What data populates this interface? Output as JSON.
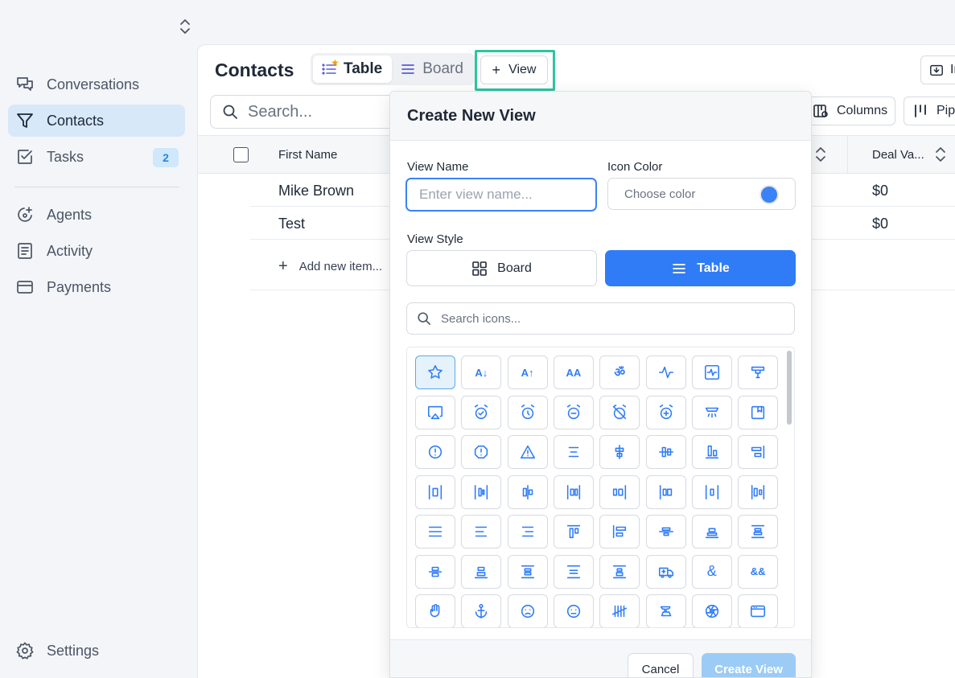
{
  "sidebar": {
    "items": [
      {
        "label": "Conversations",
        "icon": "chat-icon"
      },
      {
        "label": "Contacts",
        "icon": "filter-icon",
        "active": true
      },
      {
        "label": "Tasks",
        "icon": "checkbox-icon",
        "badge": "2"
      },
      {
        "label": "Agents",
        "icon": "sparkle-icon"
      },
      {
        "label": "Activity",
        "icon": "document-icon"
      },
      {
        "label": "Payments",
        "icon": "card-icon"
      }
    ],
    "settings_label": "Settings"
  },
  "header": {
    "title": "Contacts",
    "tabs": [
      {
        "label": "Table",
        "active": true
      },
      {
        "label": "Board"
      }
    ],
    "add_view_label": "View",
    "right_button_label": "Im"
  },
  "toolbar": {
    "search_placeholder": "Search...",
    "columns_label": "Columns",
    "pipeline_label": "Pipe"
  },
  "table": {
    "columns": [
      "First Name",
      "Deal Va..."
    ],
    "rows": [
      {
        "first_name": "Mike Brown",
        "deal_value": "$0"
      },
      {
        "first_name": "Test",
        "deal_value": "$0"
      }
    ],
    "add_item_label": "Add new item..."
  },
  "modal": {
    "title": "Create New View",
    "view_name_label": "View Name",
    "view_name_placeholder": "Enter view name...",
    "icon_color_label": "Icon Color",
    "choose_color_label": "Choose color",
    "selected_color": "#3b82f6",
    "view_style_label": "View Style",
    "style_board_label": "Board",
    "style_table_label": "Table",
    "selected_style": "Table",
    "icon_search_placeholder": "Search icons...",
    "cancel_label": "Cancel",
    "create_label": "Create View",
    "icons": [
      "star-icon",
      "sort-az-icon",
      "sort-za-icon",
      "text-size-icon",
      "om-icon",
      "activity-icon",
      "activity-square-icon",
      "spray-icon",
      "airplay-icon",
      "alarm-check-icon",
      "alarm-clock-icon",
      "alarm-minus-icon",
      "alarm-off-icon",
      "alarm-plus-icon",
      "shower-icon",
      "album-icon",
      "alert-circle-icon",
      "alert-octagon-icon",
      "alert-triangle-icon",
      "align-center-icon",
      "align-center-h-icon",
      "align-center-v-icon",
      "align-bottom-icon",
      "align-end-v-icon",
      "align-distribute-h1-icon",
      "align-distribute-h2-icon",
      "align-distribute-h3-icon",
      "align-distribute-h4-icon",
      "align-distribute-h5-icon",
      "align-distribute-h6-icon",
      "align-distribute-h7-icon",
      "align-distribute-h8-icon",
      "align-justify-icon",
      "align-left-icon",
      "align-right-icon",
      "align-top-icon",
      "align-start-v-icon",
      "align-middle-icon",
      "align-horizontal-icon",
      "align-vertical-icon",
      "align-v1-icon",
      "align-v2-icon",
      "align-v3-icon",
      "align-v4-icon",
      "align-v5-icon",
      "ambulance-icon",
      "ampersand-icon",
      "ampersands-icon",
      "hand-icon",
      "anchor-icon",
      "frown-icon",
      "meh-icon",
      "tally-icon",
      "anvil-icon",
      "aperture-icon",
      "app-window-icon"
    ]
  },
  "colors": {
    "accent": "#2f7cf6",
    "highlight_border": "#2ec4a1",
    "active_nav": "#d7e8f8"
  }
}
